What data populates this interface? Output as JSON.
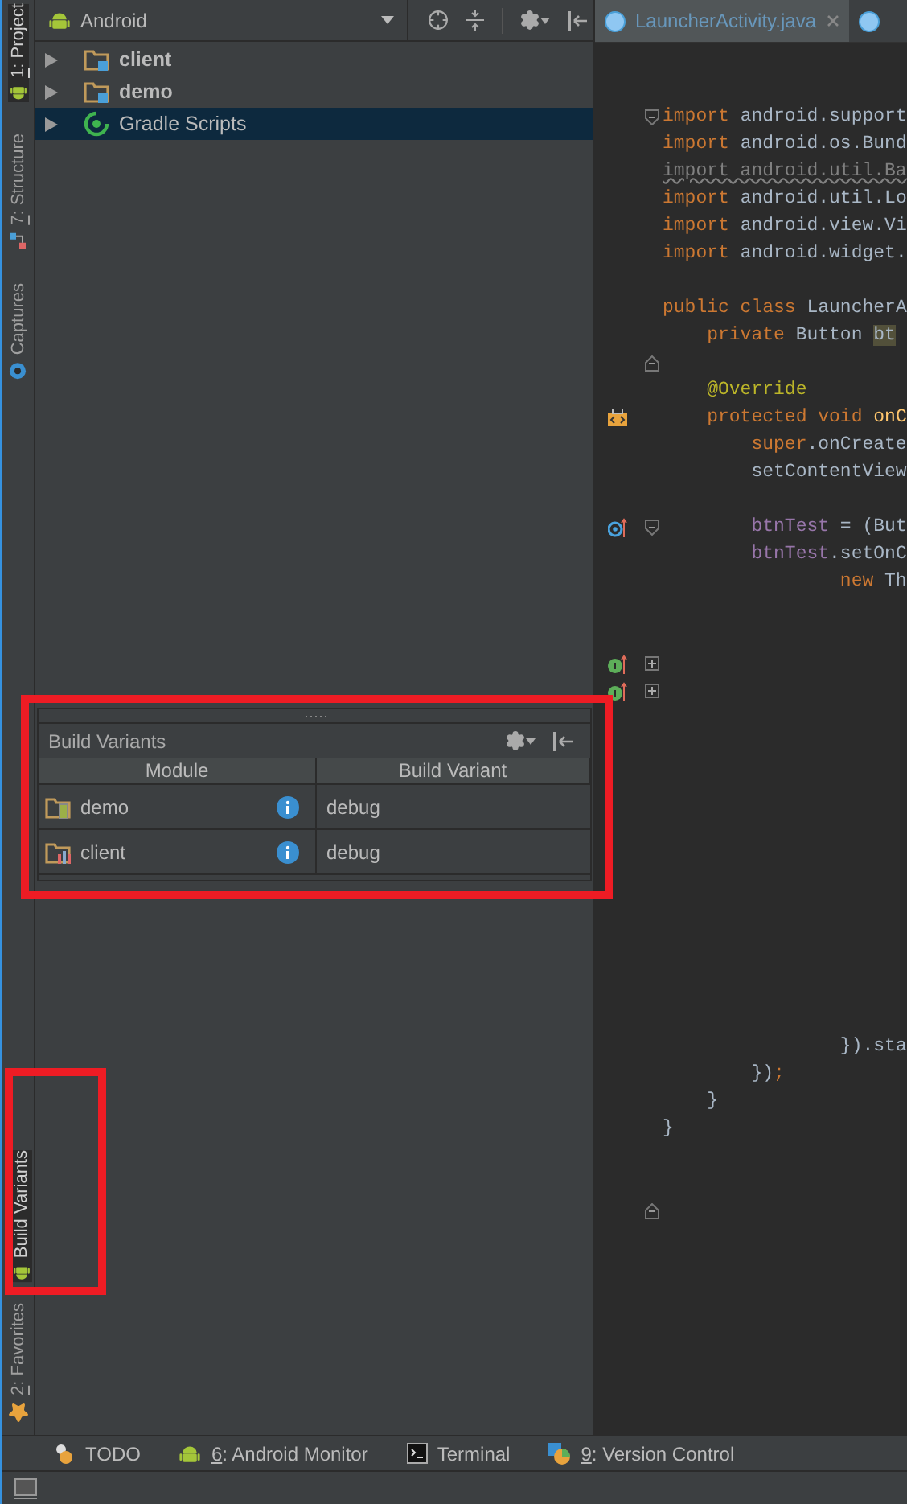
{
  "tool_strip": {
    "top": [
      {
        "mnemonic": "1",
        "label": ": Project",
        "selected": true,
        "kind": "android"
      },
      {
        "mnemonic": "7",
        "label": ": Structure",
        "selected": false,
        "kind": "structure"
      },
      {
        "label": "Captures",
        "selected": false,
        "kind": "captures"
      }
    ],
    "bottom": [
      {
        "label": "Build Variants",
        "selected": true,
        "kind": "android"
      },
      {
        "mnemonic": "2",
        "label": ": Favorites",
        "selected": false,
        "kind": "star"
      }
    ]
  },
  "project": {
    "view": "Android",
    "tree": [
      {
        "label": "client",
        "kind": "module",
        "selected": false,
        "expanded": false
      },
      {
        "label": "demo",
        "kind": "module",
        "selected": false,
        "expanded": false
      },
      {
        "label": "Gradle Scripts",
        "kind": "gradle",
        "selected": true,
        "expanded": false
      }
    ]
  },
  "build_variants": {
    "title": "Build Variants",
    "columns": [
      "Module",
      "Build Variant"
    ],
    "rows": [
      {
        "module": "demo",
        "kind": "phone",
        "variant": "debug"
      },
      {
        "module": "client",
        "kind": "library",
        "variant": "debug"
      }
    ]
  },
  "editor": {
    "tabs": [
      {
        "label": "LauncherActivity.java",
        "selected": true
      },
      {
        "selected": false
      }
    ],
    "lines": [
      {
        "kind": "code",
        "fold": {
          "kind": "start"
        },
        "tokens": [
          {
            "text": "import",
            "kind": "keyword"
          },
          {
            "text": " android.support",
            "kind": "plain"
          }
        ]
      },
      {
        "kind": "code",
        "tokens": [
          {
            "text": "import",
            "kind": "keyword"
          },
          {
            "text": " android.os.Bund",
            "kind": "plain"
          }
        ]
      },
      {
        "kind": "code",
        "tokens": [
          {
            "text": "import android.util.Ba",
            "kind": "unused"
          }
        ]
      },
      {
        "kind": "code",
        "tokens": [
          {
            "text": "import",
            "kind": "keyword"
          },
          {
            "text": " android.util.Lo",
            "kind": "plain"
          }
        ]
      },
      {
        "kind": "code",
        "tokens": [
          {
            "text": "import",
            "kind": "keyword"
          },
          {
            "text": " android.view.Vi",
            "kind": "plain"
          }
        ]
      },
      {
        "kind": "code",
        "tokens": [
          {
            "text": "import",
            "kind": "keyword"
          },
          {
            "text": " android.widget.",
            "kind": "plain"
          }
        ]
      },
      {
        "kind": "blank"
      },
      {
        "kind": "code",
        "tokens": [
          {
            "text": "public class",
            "kind": "keyword"
          },
          {
            "text": " LauncherA",
            "kind": "plain"
          }
        ]
      },
      {
        "kind": "code",
        "tokens": [
          {
            "text": "    private",
            "kind": "keyword"
          },
          {
            "text": " Button ",
            "kind": "plain"
          },
          {
            "text": "bt",
            "kind": "highlighted"
          }
        ]
      },
      {
        "kind": "blank",
        "fold": {
          "kind": "end"
        }
      },
      {
        "kind": "code",
        "tokens": [
          {
            "text": "    @Override",
            "kind": "annotation"
          }
        ]
      },
      {
        "kind": "code",
        "gutter": {
          "kind": "override"
        },
        "tokens": [
          {
            "text": "    protected void",
            "kind": "keyword"
          },
          {
            "text": " onC",
            "kind": "method"
          }
        ]
      },
      {
        "kind": "code",
        "tokens": [
          {
            "text": "        super",
            "kind": "keyword"
          },
          {
            "text": ".onCreate",
            "kind": "plain"
          }
        ]
      },
      {
        "kind": "code",
        "tokens": [
          {
            "text": "        setContentView",
            "kind": "plain"
          }
        ]
      },
      {
        "kind": "blank"
      },
      {
        "kind": "code",
        "gutter": {
          "kind": "target"
        },
        "fold": {
          "kind": "start"
        },
        "tokens": [
          {
            "text": "        btnTest",
            "kind": "field"
          },
          {
            "text": " = (But",
            "kind": "plain"
          }
        ]
      },
      {
        "kind": "code",
        "tokens": [
          {
            "text": "        btnTest",
            "kind": "field"
          },
          {
            "text": ".setOnC",
            "kind": "plain"
          }
        ]
      },
      {
        "kind": "code",
        "tokens": [
          {
            "text": "                new",
            "kind": "keyword"
          },
          {
            "text": " Th",
            "kind": "plain"
          }
        ]
      },
      {
        "kind": "blank"
      },
      {
        "kind": "blank"
      },
      {
        "kind": "blank",
        "gutter": {
          "kind": "implements"
        },
        "fold": {
          "kind": "plus"
        }
      },
      {
        "kind": "blank",
        "gutter": {
          "kind": "implements"
        },
        "fold": {
          "kind": "plus"
        }
      },
      {
        "kind": "blank"
      },
      {
        "kind": "blank"
      },
      {
        "kind": "blank"
      },
      {
        "kind": "blank"
      },
      {
        "kind": "blank"
      },
      {
        "kind": "blank"
      },
      {
        "kind": "blank"
      },
      {
        "kind": "blank"
      },
      {
        "kind": "blank"
      },
      {
        "kind": "blank"
      },
      {
        "kind": "blank"
      },
      {
        "kind": "blank"
      },
      {
        "kind": "code",
        "tokens": [
          {
            "text": "                })",
            "kind": "plain"
          },
          {
            "text": ".sta",
            "kind": "plain"
          }
        ]
      },
      {
        "kind": "code",
        "tokens": [
          {
            "text": "        })",
            "kind": "plain"
          },
          {
            "text": ";",
            "kind": "keyword"
          }
        ]
      },
      {
        "kind": "code",
        "tokens": [
          {
            "text": "    }",
            "kind": "plain"
          }
        ]
      },
      {
        "kind": "code",
        "tokens": [
          {
            "text": "}",
            "kind": "plain"
          }
        ]
      },
      {
        "kind": "blank"
      },
      {
        "kind": "blank"
      },
      {
        "kind": "blank",
        "fold": {
          "kind": "end"
        }
      }
    ]
  },
  "bottom_tools": [
    {
      "label": "TODO",
      "kind": "todo"
    },
    {
      "mnemonic": "6",
      "label": ": Android Monitor",
      "kind": "android"
    },
    {
      "label": "Terminal",
      "kind": "terminal"
    },
    {
      "mnemonic": "9",
      "label": ": Version Control",
      "kind": "vcs"
    }
  ]
}
